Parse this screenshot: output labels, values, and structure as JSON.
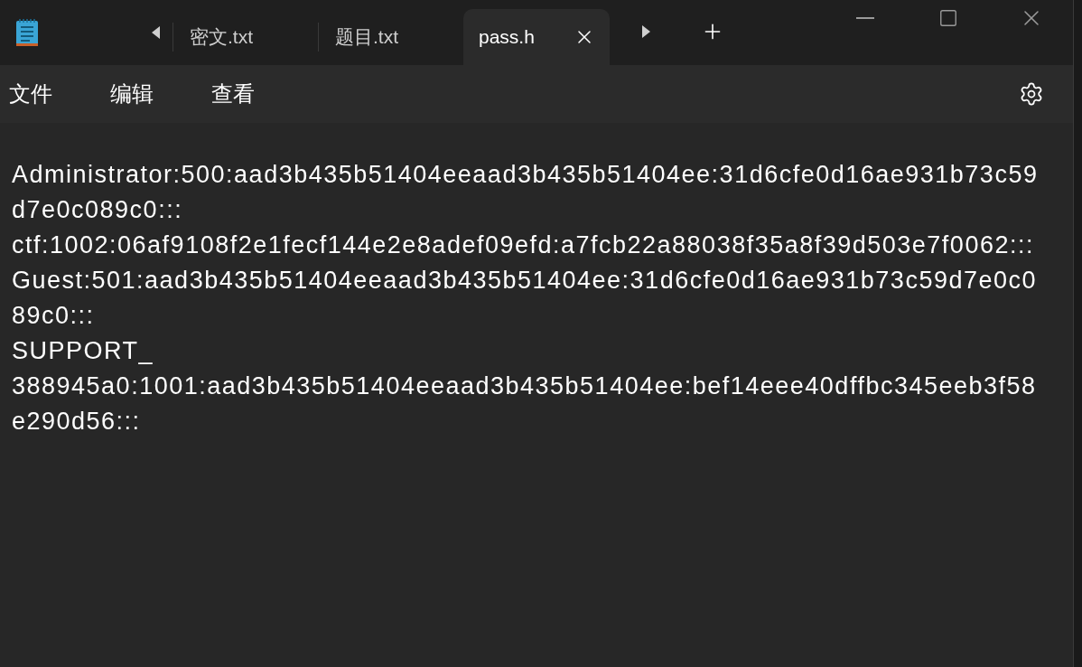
{
  "tabs": [
    {
      "label": "密文.txt",
      "selected": false
    },
    {
      "label": "题目.txt",
      "selected": false
    },
    {
      "label": "pass.h",
      "selected": true
    }
  ],
  "menu": [
    "文件",
    "编辑",
    "查看"
  ],
  "document_lines": [
    "Administrator:500:aad3b435b51404eeaad3b435b51404ee:31d6cfe0d16ae931b73c59",
    "d7e0c089c0:::",
    "ctf:1002:06af9108f2e1fecf144e2e8adef09efd:a7fcb22a88038f35a8f39d503e7f0062:::",
    "Guest:501:aad3b435b51404eeaad3b435b51404ee:31d6cfe0d16ae931b73c59d7e0c0",
    "89c0:::",
    "SUPPORT_",
    "388945a0:1001:aad3b435b51404eeaad3b435b51404ee:bef14eee40dffbc345eeb3f58",
    "e290d56:::"
  ]
}
